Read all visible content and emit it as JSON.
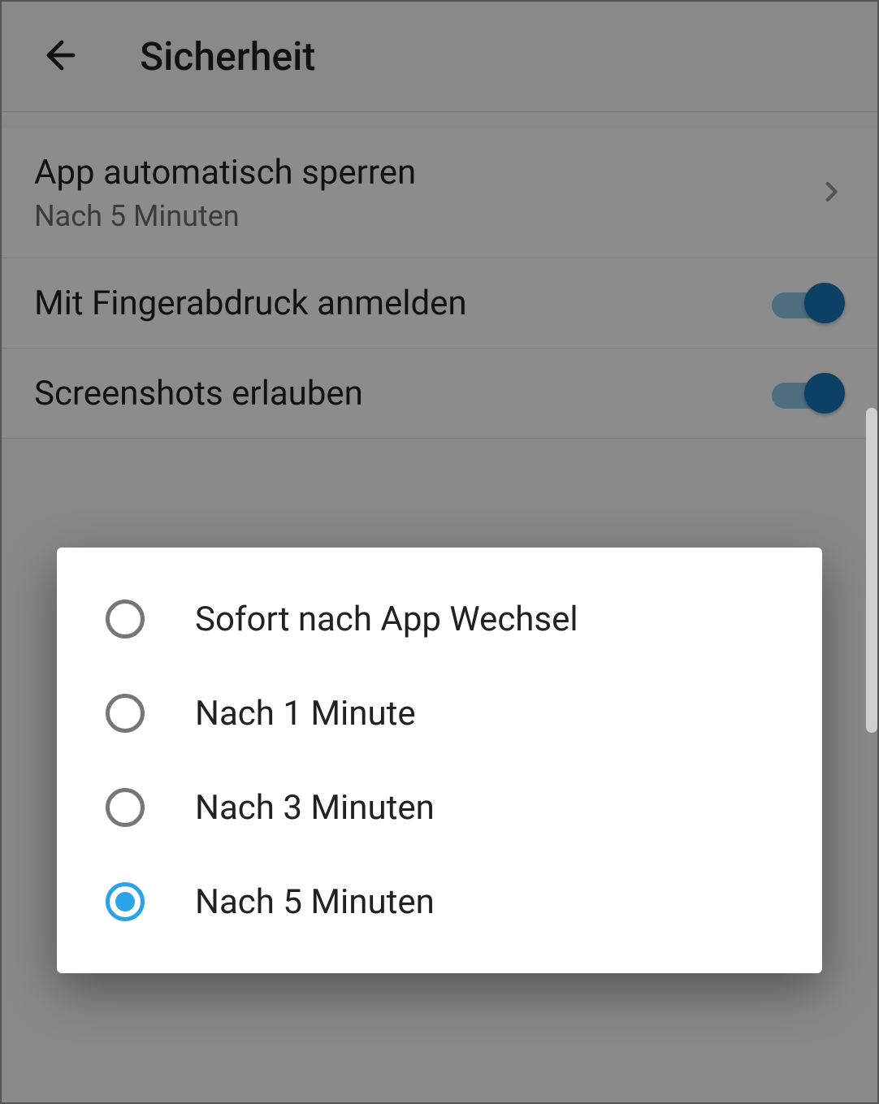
{
  "header": {
    "title": "Sicherheit"
  },
  "settings": {
    "auto_lock": {
      "title": "App automatisch sperren",
      "value": "Nach 5 Minuten"
    },
    "fingerprint": {
      "title": "Mit Fingerabdruck anmelden",
      "enabled": true
    },
    "screenshots": {
      "title": "Screenshots erlauben",
      "enabled": true
    }
  },
  "dialog": {
    "options": [
      {
        "label": "Sofort nach App Wechsel",
        "selected": false
      },
      {
        "label": "Nach 1 Minute",
        "selected": false
      },
      {
        "label": "Nach 3 Minuten",
        "selected": false
      },
      {
        "label": "Nach 5 Minuten",
        "selected": true
      }
    ]
  },
  "colors": {
    "accent": "#1976b8",
    "radio_selected": "#2aa3e8"
  }
}
